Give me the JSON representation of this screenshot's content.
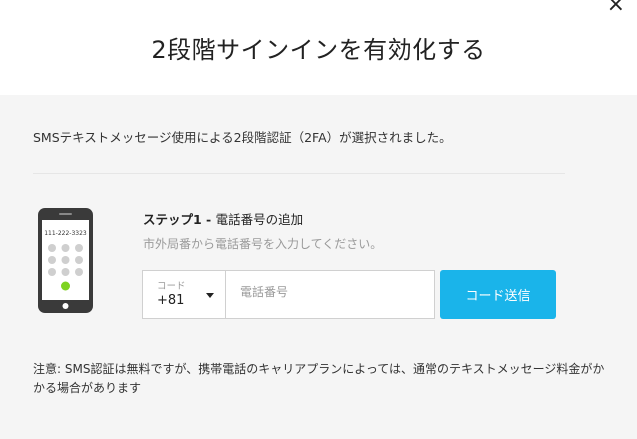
{
  "dialog": {
    "close_glyph": "×",
    "title": "2段階サインインを有効化する"
  },
  "intro_text": "SMSテキストメッセージ使用による2段階認証（2FA）が選択されました。",
  "phone_illustration": {
    "number": "111-222-3323",
    "accent_color": "#7ed321"
  },
  "step": {
    "label": "ステップ1 - ",
    "title": "電話番号の追加",
    "subtitle": "市外局番から電話番号を入力してください。"
  },
  "country_code": {
    "label": "コード",
    "value": "+81"
  },
  "phone_input": {
    "placeholder": "電話番号",
    "value": ""
  },
  "send_button": {
    "label": "コード送信",
    "color": "#1ab4ea"
  },
  "note": "注意: SMS認証は無料ですが、携帯電話のキャリアプランによっては、通常のテキストメッセージ料金がかかる場合があります"
}
